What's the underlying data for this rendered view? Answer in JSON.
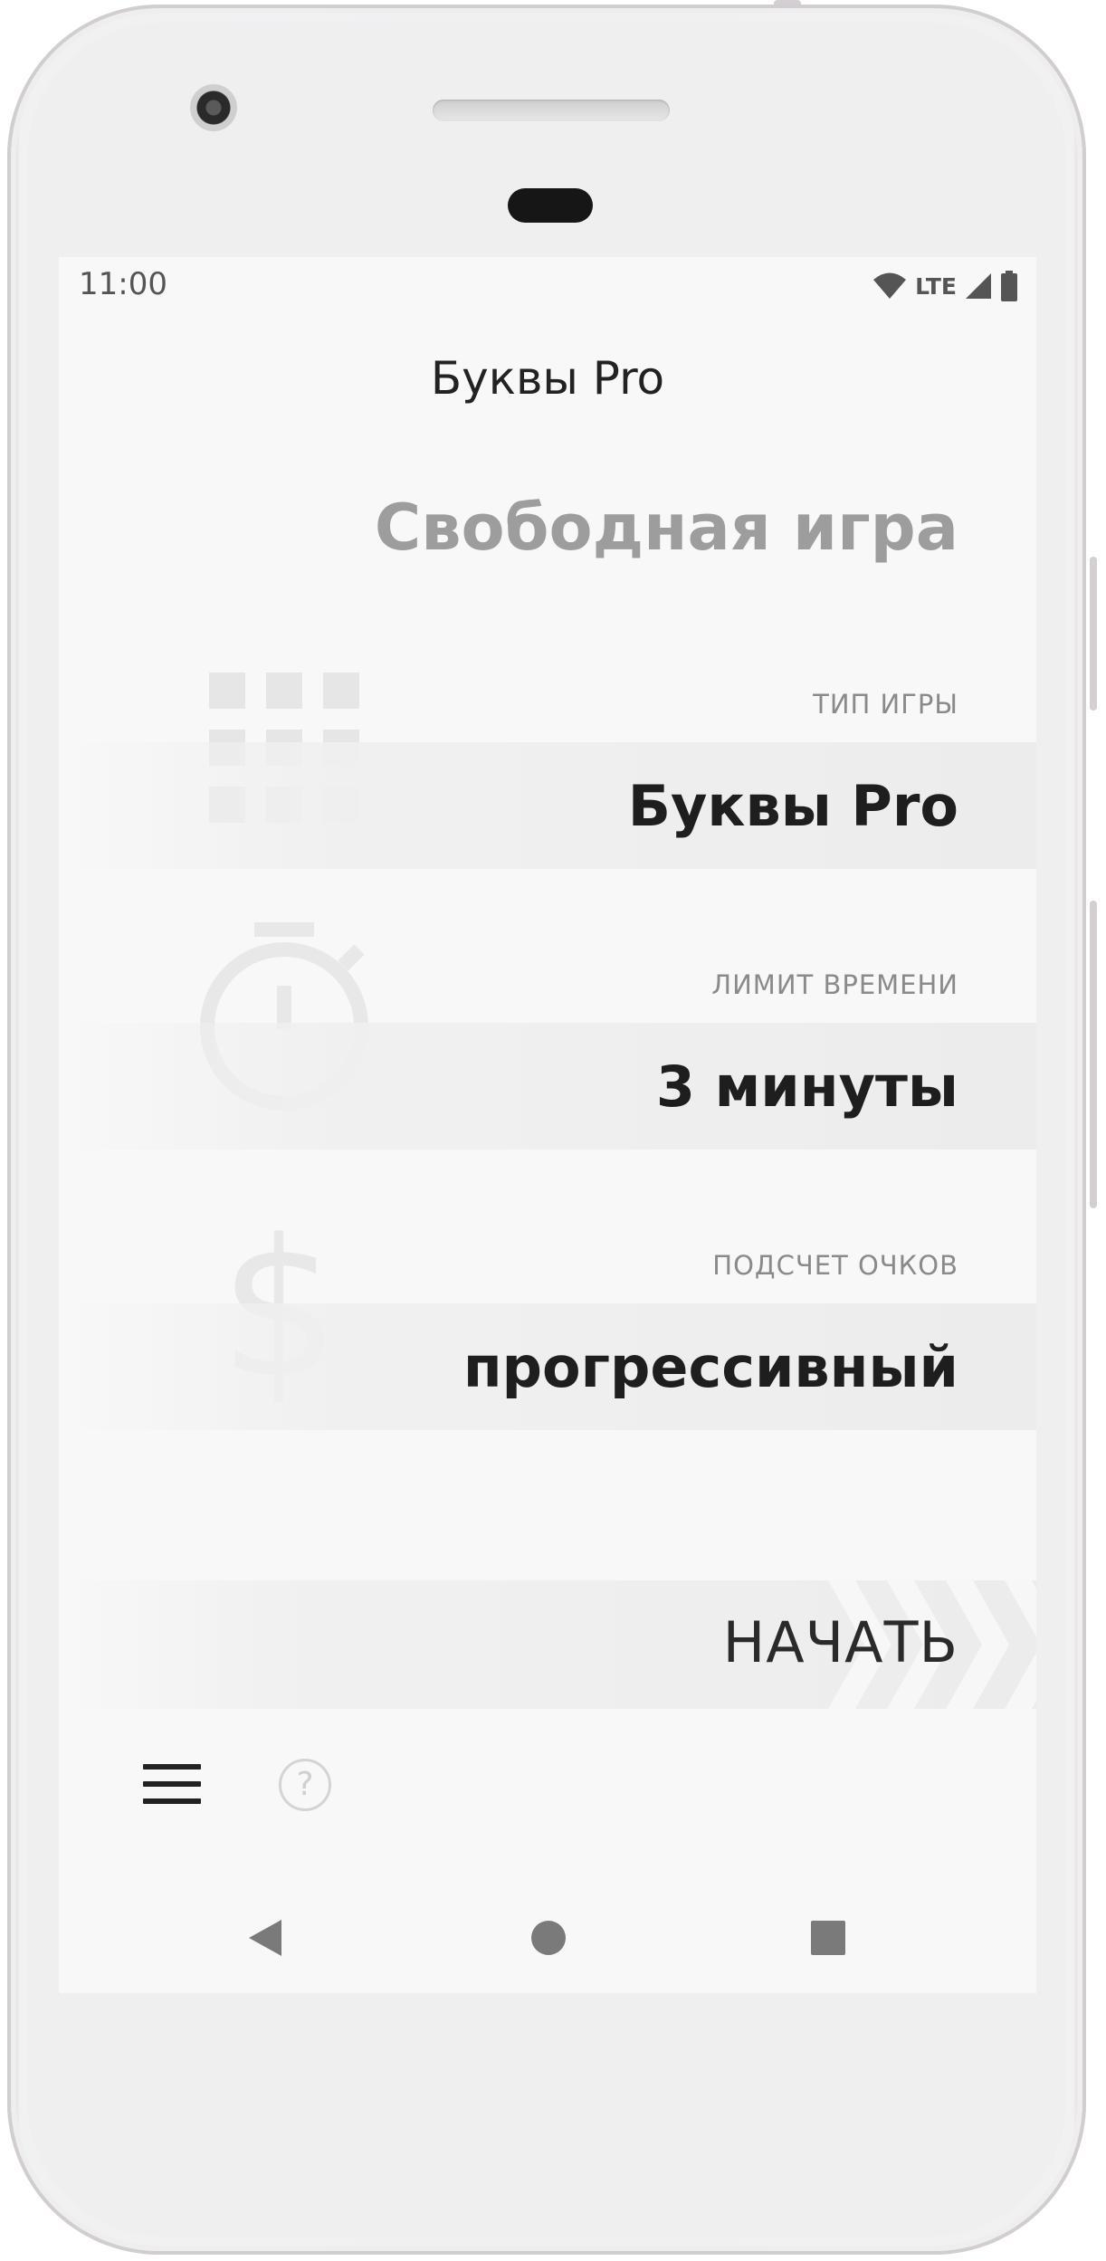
{
  "status_bar": {
    "time": "11:00",
    "network": "LTE",
    "icons": [
      "wifi-icon",
      "cell-signal-icon",
      "battery-icon"
    ]
  },
  "app_bar": {
    "title": "Буквы Pro"
  },
  "screen": {
    "mode_title": "Свободная игра"
  },
  "settings": [
    {
      "id": "game-type",
      "label": "ТИП ИГРЫ",
      "value": "Буквы Pro",
      "icon": "grid-icon"
    },
    {
      "id": "time-limit",
      "label": "ЛИМИТ ВРЕМЕНИ",
      "value": "3 минуты",
      "icon": "stopwatch-icon"
    },
    {
      "id": "scoring",
      "label": "ПОДСЧЕТ ОЧКОВ",
      "value": "прогрессивный",
      "icon": "dollar-icon"
    }
  ],
  "start_button": {
    "label": "НАЧАТЬ"
  },
  "bottom_bar": {
    "menu_icon": "hamburger-menu-icon",
    "help_icon": "help-icon",
    "help_glyph": "?"
  },
  "navigation": {
    "icons": [
      "nav-back-icon",
      "nav-home-icon",
      "nav-recents-icon"
    ]
  },
  "colors": {
    "screen_bg": "#f8f8f8",
    "band_bg": "#ececec",
    "muted_text": "#8a8a8a",
    "title_gray": "#9d9d9d"
  }
}
